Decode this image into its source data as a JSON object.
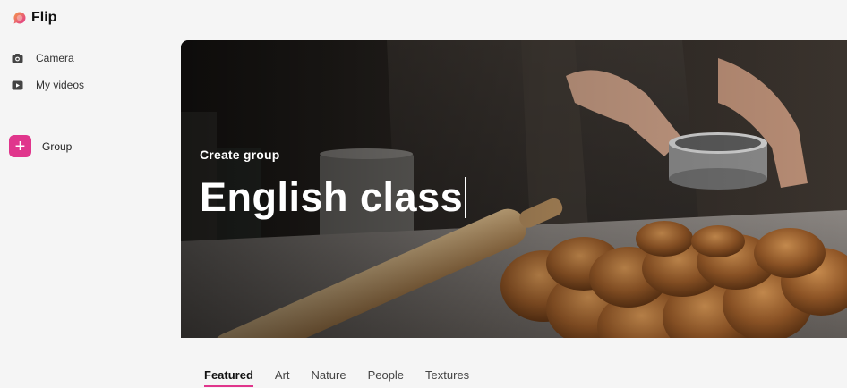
{
  "app": {
    "brand_name": "Flip",
    "accent_color": "#e0368c"
  },
  "sidebar": {
    "items": [
      {
        "label": "Camera",
        "icon": "camera-icon"
      },
      {
        "label": "My videos",
        "icon": "video-icon"
      }
    ],
    "group": {
      "label": "Group",
      "icon": "plus-icon"
    }
  },
  "hero": {
    "subtitle": "Create group",
    "title": "English class",
    "image": "baking-bread-photo"
  },
  "tabs": [
    {
      "label": "Featured",
      "active": true
    },
    {
      "label": "Art",
      "active": false
    },
    {
      "label": "Nature",
      "active": false
    },
    {
      "label": "People",
      "active": false
    },
    {
      "label": "Textures",
      "active": false
    }
  ]
}
